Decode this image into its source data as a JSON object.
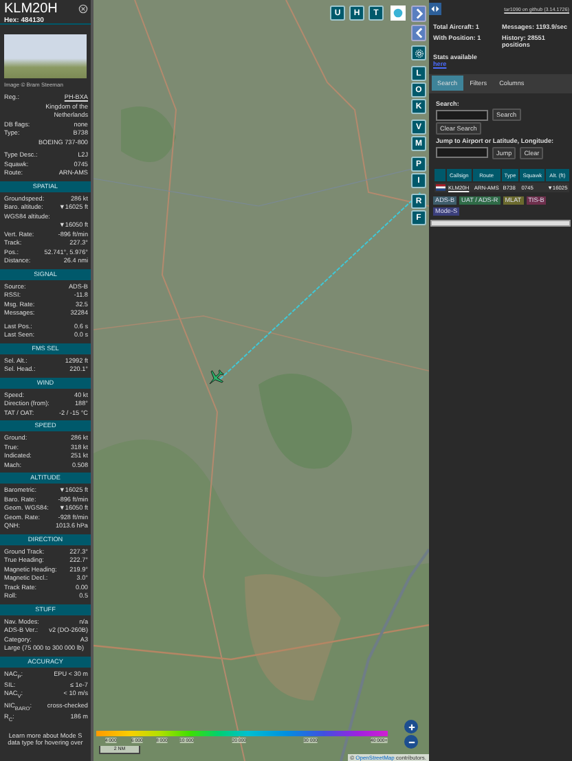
{
  "aircraft_panel": {
    "callsign": "KLM20H",
    "hex": "Hex: 484130",
    "photo_credit": "Image © Bram Steeman",
    "sections": [
      {
        "groups": [
          [
            {
              "kind": "link",
              "label": "Reg.:",
              "value": "PH-BXA"
            },
            {
              "kind": "value_only",
              "value": "Kingdom of the Netherlands"
            },
            {
              "kind": "pair",
              "label": "DB flags:",
              "value": "none"
            },
            {
              "kind": "pair",
              "label": "Type:",
              "value": "B738"
            },
            {
              "kind": "value_only",
              "value": "BOEING 737-800"
            }
          ],
          [
            {
              "kind": "pair",
              "label": "Type Desc.:",
              "value": "L2J"
            },
            {
              "kind": "pair",
              "label": "Squawk:",
              "value": "0745"
            },
            {
              "kind": "pair",
              "label": "Route:",
              "value": "ARN-AMS"
            }
          ]
        ]
      },
      {
        "title": "SPATIAL",
        "groups": [
          [
            {
              "kind": "pair",
              "label": "Groundspeed:",
              "value": "286 kt"
            },
            {
              "kind": "pair",
              "label": "Baro. altitude:",
              "value": "▼16025 ft"
            },
            {
              "kind": "label_only",
              "label": "WGS84 altitude:"
            },
            {
              "kind": "value_only",
              "value": "▼16050 ft"
            },
            {
              "kind": "pair",
              "label": "Vert. Rate:",
              "value": "-896 ft/min"
            },
            {
              "kind": "pair",
              "label": "Track:",
              "value": "227.3°"
            },
            {
              "kind": "pair",
              "label": "Pos.:",
              "value": "52.741°, 5.976°"
            },
            {
              "kind": "pair",
              "label": "Distance:",
              "value": "26.4 nmi"
            }
          ]
        ]
      },
      {
        "title": "SIGNAL",
        "groups": [
          [
            {
              "kind": "pair",
              "label": "Source:",
              "value": "ADS-B"
            },
            {
              "kind": "pair",
              "label": "RSSI:",
              "value": "-11.8"
            },
            {
              "kind": "pair",
              "label": "Msg. Rate:",
              "value": "32.5"
            },
            {
              "kind": "pair",
              "label": "Messages:",
              "value": "32284"
            }
          ],
          [
            {
              "kind": "pair",
              "label": "Last Pos.:",
              "value": "0.6 s"
            },
            {
              "kind": "pair",
              "label": "Last Seen:",
              "value": "0.0 s"
            }
          ]
        ]
      },
      {
        "title": "FMS SEL",
        "groups": [
          [
            {
              "kind": "pair",
              "label": "Sel. Alt.:",
              "value": "12992 ft"
            },
            {
              "kind": "pair",
              "label": "Sel. Head.:",
              "value": "220.1°"
            }
          ]
        ]
      },
      {
        "title": "WIND",
        "groups": [
          [
            {
              "kind": "pair",
              "label": "Speed:",
              "value": "40 kt"
            },
            {
              "kind": "pair",
              "label": "Direction (from):",
              "value": "188°"
            },
            {
              "kind": "pair",
              "label": "TAT / OAT:",
              "value": "-2 / -15 °C"
            }
          ]
        ]
      },
      {
        "title": "SPEED",
        "groups": [
          [
            {
              "kind": "pair",
              "label": "Ground:",
              "value": "286 kt"
            },
            {
              "kind": "pair",
              "label": "True:",
              "value": "318 kt"
            },
            {
              "kind": "pair",
              "label": "Indicated:",
              "value": "251 kt"
            },
            {
              "kind": "pair",
              "label": "Mach:",
              "value": "0.508"
            }
          ]
        ]
      },
      {
        "title": "ALTITUDE",
        "groups": [
          [
            {
              "kind": "pair",
              "label": "Barometric:",
              "value": "▼16025 ft"
            },
            {
              "kind": "pair",
              "label": "Baro. Rate:",
              "value": "-896 ft/min"
            },
            {
              "kind": "pair",
              "label": "Geom. WGS84:",
              "value": "▼16050 ft"
            },
            {
              "kind": "pair",
              "label": "Geom. Rate:",
              "value": "-928 ft/min"
            },
            {
              "kind": "pair",
              "label": "QNH:",
              "value": "1013.6 hPa"
            }
          ]
        ]
      },
      {
        "title": "DIRECTION",
        "groups": [
          [
            {
              "kind": "pair",
              "label": "Ground Track:",
              "value": "227.3°"
            },
            {
              "kind": "pair",
              "label": "True Heading:",
              "value": "222.7°"
            },
            {
              "kind": "pair",
              "label": "Magnetic Heading:",
              "value": "219.9°"
            },
            {
              "kind": "pair",
              "label": "Magnetic Decl.:",
              "value": "3.0°"
            },
            {
              "kind": "pair",
              "label": "Track Rate:",
              "value": "0.00"
            },
            {
              "kind": "pair",
              "label": "Roll:",
              "value": "0.5"
            }
          ]
        ]
      },
      {
        "title": "STUFF",
        "groups": [
          [
            {
              "kind": "pair",
              "label": "Nav. Modes:",
              "value": "n/a"
            },
            {
              "kind": "pair",
              "label": "ADS-B Ver.:",
              "value": "v2 (DO-260B)"
            },
            {
              "kind": "pair",
              "label": "Category:",
              "value": "A3"
            },
            {
              "kind": "note",
              "value": "Large (75 000 to 300 000 lb)"
            }
          ]
        ]
      },
      {
        "title": "ACCURACY",
        "groups": [
          [
            {
              "kind": "pair",
              "label": "NAC$_{P}$:",
              "value": "EPU < 30 m"
            },
            {
              "kind": "pair",
              "label": "SIL:",
              "value": "≤ 1e-7"
            },
            {
              "kind": "pair",
              "label": "NAC$_{V}$:",
              "value": "< 10 m/s"
            },
            {
              "kind": "pair",
              "label": "NIC$_{BARO}$:",
              "value": "cross-checked"
            },
            {
              "kind": "pair",
              "label": "R$_{C}$:",
              "value": "186 m"
            }
          ]
        ]
      }
    ],
    "footer_note": "Learn more about Mode S data type for hovering over"
  },
  "map": {
    "top_buttons": [
      "U",
      "H",
      "T"
    ],
    "side_groups": [
      [
        "L",
        "O",
        "K"
      ],
      [
        "V",
        "M"
      ],
      [
        "P",
        "I"
      ],
      [
        "R",
        "F"
      ]
    ],
    "altitude_scale": [
      "4 000",
      "6 000",
      "8 000",
      "10 000",
      "20 000",
      "30 000",
      "40 000+"
    ],
    "scale_label": "2 NM",
    "attribution": {
      "prefix": "©",
      "link": "OpenStreetMap",
      "suffix": "contributors."
    }
  },
  "side_panel": {
    "github_link": "tar1090 on github (3.14.1726)",
    "stats": [
      "Total Aircraft: 1",
      "Messages: 1193.9/sec",
      "With Position: 1",
      "History: 28551 positions"
    ],
    "stats_note": {
      "text": "Stats available",
      "link": "here"
    },
    "tabs": [
      {
        "label": "Search",
        "selected": true
      },
      {
        "label": "Filters",
        "selected": false
      },
      {
        "label": "Columns",
        "selected": false
      }
    ],
    "search": {
      "label": "Search:",
      "button": "Search",
      "clear_button": "Clear Search"
    },
    "jump": {
      "label": "Jump to Airport or Latitude, Longitude:",
      "button": "Jump",
      "clear_button": "Clear"
    },
    "table": {
      "columns": [
        "Callsign",
        "Route",
        "Type",
        "Squawk",
        "Alt. (ft)"
      ],
      "rows": [
        {
          "cells": [
            "KLM20H",
            "ARN-AMS",
            "B738",
            "0745",
            "▼16025"
          ]
        }
      ]
    },
    "legend": [
      {
        "label": "ADS-B",
        "color": "#3e5d6b"
      },
      {
        "label": "UAT / ADS-R",
        "color": "#2f6b47"
      },
      {
        "label": "MLAT",
        "color": "#6b6a2e"
      },
      {
        "label": "TIS-B",
        "color": "#6e2f4c"
      },
      {
        "label": "Mode-S",
        "color": "#3b3f7c"
      }
    ]
  }
}
